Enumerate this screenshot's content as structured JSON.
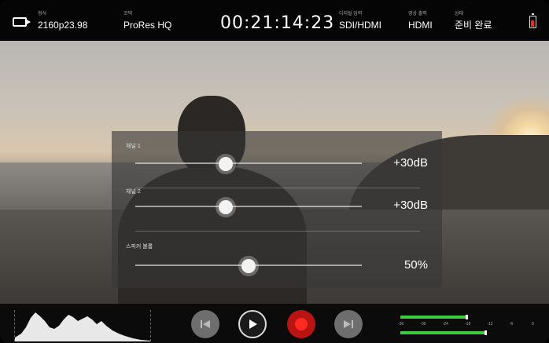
{
  "status_bar": {
    "format_label": "형식",
    "format_value": "2160p23.98",
    "codec_label": "코덱",
    "codec_value": "ProRes HQ",
    "timecode": "00:21:14:23",
    "input_label": "디지털 입력",
    "input_value": "SDI/HDMI",
    "output_label": "영상 출력",
    "output_value": "HDMI",
    "status_label": "상태",
    "status_value": "준비 완료",
    "icons": [
      "camera-icon",
      "battery-icon"
    ]
  },
  "audio_menu": {
    "ch1": {
      "label": "채널 1",
      "value_text": "+30dB",
      "level": 0.4
    },
    "ch2": {
      "label": "채널 2",
      "value_text": "+30dB",
      "level": 0.4
    },
    "speaker": {
      "label": "스피커 볼륨",
      "value_text": "50%",
      "level": 0.5
    }
  },
  "transport": {
    "buttons": [
      "previous-clip-button",
      "play-button",
      "record-button",
      "next-clip-button"
    ]
  },
  "meters": {
    "scale": [
      "-36",
      "-30",
      "-24",
      "-18",
      "-12",
      "-6",
      "0"
    ],
    "ch1_level": 0.5,
    "ch2_level": 0.64
  },
  "colors": {
    "record": "#ff2a20",
    "meter": "#3ecb3e",
    "battery_low": "#e0301e"
  }
}
